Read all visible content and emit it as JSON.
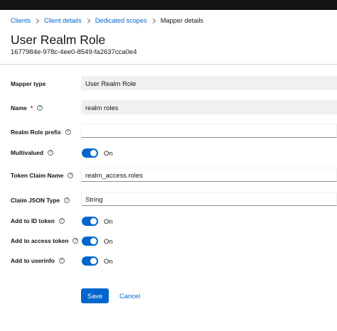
{
  "breadcrumb": [
    "Clients",
    "Client details",
    "Dedicated scopes",
    "Mapper details"
  ],
  "page": {
    "title": "User Realm Role",
    "subtitle": "1677984e-978c-4ee0-8549-fa2637cca0e4"
  },
  "form": {
    "mapper_type": {
      "label": "Mapper type",
      "value": "User Realm Role"
    },
    "name": {
      "label": "Name",
      "required_mark": "*",
      "value": "realm roles"
    },
    "realm_role_prefix": {
      "label": "Realm Role prefix",
      "value": ""
    },
    "multivalued": {
      "label": "Multivalued",
      "state": "On"
    },
    "token_claim_name": {
      "label": "Token Claim Name",
      "value": "realm_access.roles"
    },
    "claim_json_type": {
      "label": "Claim JSON Type",
      "value": "String"
    },
    "add_to_id_token": {
      "label": "Add to ID token",
      "state": "On"
    },
    "add_to_access_token": {
      "label": "Add to access token",
      "state": "On"
    },
    "add_to_userinfo": {
      "label": "Add to userinfo",
      "state": "On"
    }
  },
  "actions": {
    "save": "Save",
    "cancel": "Cancel"
  },
  "help_glyph": "?",
  "colors": {
    "primary": "#0066cc",
    "required": "#c9190b",
    "topbar": "#151515",
    "field_bg": "#f0f0f0"
  }
}
